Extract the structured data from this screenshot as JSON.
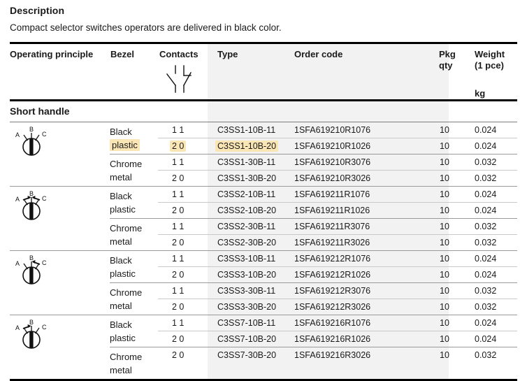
{
  "description": {
    "title": "Description",
    "text": "Compact selector switches operators are delivered in black color."
  },
  "table": {
    "headers": {
      "operating_principle": "Operating principle",
      "bezel": "Bezel",
      "contacts": "Contacts",
      "contacts_symbol": "contacts-no-nc-symbol",
      "type": "Type",
      "order_code": "Order code",
      "pkg_qty_line1": "Pkg",
      "pkg_qty_line2": "qty",
      "weight_line1": "Weight",
      "weight_line2": "(1 pce)",
      "weight_unit": "kg"
    },
    "section_title": "Short handle",
    "groups": [
      {
        "icon": "selector-switch-3pos-maintained",
        "icon_labels": {
          "a": "A",
          "b": "B",
          "c": "C"
        },
        "arrows": "none",
        "bezels": [
          {
            "line1": "Black",
            "line2": "plastic",
            "line1_highlight": false,
            "line2_highlight": true,
            "rows": [
              {
                "contacts": "1 1",
                "type": "C3SS1-10B-11",
                "order_code": "1SFA619210R1076",
                "pkg_qty": "10",
                "weight": "0.024",
                "contacts_highlight": false,
                "type_highlight": false
              },
              {
                "contacts": "2 0",
                "type": "C3SS1-10B-20",
                "order_code": "1SFA619210R1026",
                "pkg_qty": "10",
                "weight": "0.024",
                "contacts_highlight": true,
                "type_highlight": true
              }
            ]
          },
          {
            "line1": "Chrome",
            "line2": "metal",
            "line1_highlight": false,
            "line2_highlight": false,
            "rows": [
              {
                "contacts": "1 1",
                "type": "C3SS1-30B-11",
                "order_code": "1SFA619210R3076",
                "pkg_qty": "10",
                "weight": "0.032",
                "contacts_highlight": false,
                "type_highlight": false
              },
              {
                "contacts": "2 0",
                "type": "C3SS1-30B-20",
                "order_code": "1SFA619210R3026",
                "pkg_qty": "10",
                "weight": "0.032",
                "contacts_highlight": false,
                "type_highlight": false
              }
            ]
          }
        ]
      },
      {
        "icon": "selector-switch-3pos-spring-return-both",
        "icon_labels": {
          "a": "A",
          "b": "B",
          "c": "C"
        },
        "arrows": "both",
        "bezels": [
          {
            "line1": "Black",
            "line2": "plastic",
            "line1_highlight": false,
            "line2_highlight": false,
            "rows": [
              {
                "contacts": "1 1",
                "type": "C3SS2-10B-11",
                "order_code": "1SFA619211R1076",
                "pkg_qty": "10",
                "weight": "0.024",
                "contacts_highlight": false,
                "type_highlight": false
              },
              {
                "contacts": "2 0",
                "type": "C3SS2-10B-20",
                "order_code": "1SFA619211R1026",
                "pkg_qty": "10",
                "weight": "0.024",
                "contacts_highlight": false,
                "type_highlight": false
              }
            ]
          },
          {
            "line1": "Chrome",
            "line2": "metal",
            "line1_highlight": false,
            "line2_highlight": false,
            "rows": [
              {
                "contacts": "1 1",
                "type": "C3SS2-30B-11",
                "order_code": "1SFA619211R3076",
                "pkg_qty": "10",
                "weight": "0.032",
                "contacts_highlight": false,
                "type_highlight": false
              },
              {
                "contacts": "2 0",
                "type": "C3SS2-30B-20",
                "order_code": "1SFA619211R3026",
                "pkg_qty": "10",
                "weight": "0.032",
                "contacts_highlight": false,
                "type_highlight": false
              }
            ]
          }
        ]
      },
      {
        "icon": "selector-switch-3pos-spring-return-right",
        "icon_labels": {
          "a": "A",
          "b": "B",
          "c": "C"
        },
        "arrows": "right",
        "bezels": [
          {
            "line1": "Black",
            "line2": "plastic",
            "line1_highlight": false,
            "line2_highlight": false,
            "rows": [
              {
                "contacts": "1 1",
                "type": "C3SS3-10B-11",
                "order_code": "1SFA619212R1076",
                "pkg_qty": "10",
                "weight": "0.024",
                "contacts_highlight": false,
                "type_highlight": false
              },
              {
                "contacts": "2 0",
                "type": "C3SS3-10B-20",
                "order_code": "1SFA619212R1026",
                "pkg_qty": "10",
                "weight": "0.024",
                "contacts_highlight": false,
                "type_highlight": false
              }
            ]
          },
          {
            "line1": "Chrome",
            "line2": "metal",
            "line1_highlight": false,
            "line2_highlight": false,
            "rows": [
              {
                "contacts": "1 1",
                "type": "C3SS3-30B-11",
                "order_code": "1SFA619212R3076",
                "pkg_qty": "10",
                "weight": "0.032",
                "contacts_highlight": false,
                "type_highlight": false
              },
              {
                "contacts": "2 0",
                "type": "C3SS3-30B-20",
                "order_code": "1SFA619212R3026",
                "pkg_qty": "10",
                "weight": "0.032",
                "contacts_highlight": false,
                "type_highlight": false
              }
            ]
          }
        ]
      },
      {
        "icon": "selector-switch-3pos-spring-return-left",
        "icon_labels": {
          "a": "A",
          "b": "B",
          "c": "C"
        },
        "arrows": "left",
        "bezels": [
          {
            "line1": "Black",
            "line2": "plastic",
            "line1_highlight": false,
            "line2_highlight": false,
            "rows": [
              {
                "contacts": "1 1",
                "type": "C3SS7-10B-11",
                "order_code": "1SFA619216R1076",
                "pkg_qty": "10",
                "weight": "0.024",
                "contacts_highlight": false,
                "type_highlight": false
              },
              {
                "contacts": "2 0",
                "type": "C3SS7-10B-20",
                "order_code": "1SFA619216R1026",
                "pkg_qty": "10",
                "weight": "0.024",
                "contacts_highlight": false,
                "type_highlight": false
              }
            ]
          },
          {
            "line1": "Chrome",
            "line2": "metal",
            "line1_highlight": false,
            "line2_highlight": false,
            "rows": [
              {
                "contacts": "2 0",
                "type": "C3SS7-30B-20",
                "order_code": "1SFA619216R3026",
                "pkg_qty": "10",
                "weight": "0.032",
                "contacts_highlight": false,
                "type_highlight": false
              }
            ]
          }
        ]
      }
    ]
  },
  "colors": {
    "highlight": "#fae6b5",
    "column_shade": "#f2f2f2",
    "rule_strong": "#000000",
    "rule_light": "#c9c9c9"
  }
}
